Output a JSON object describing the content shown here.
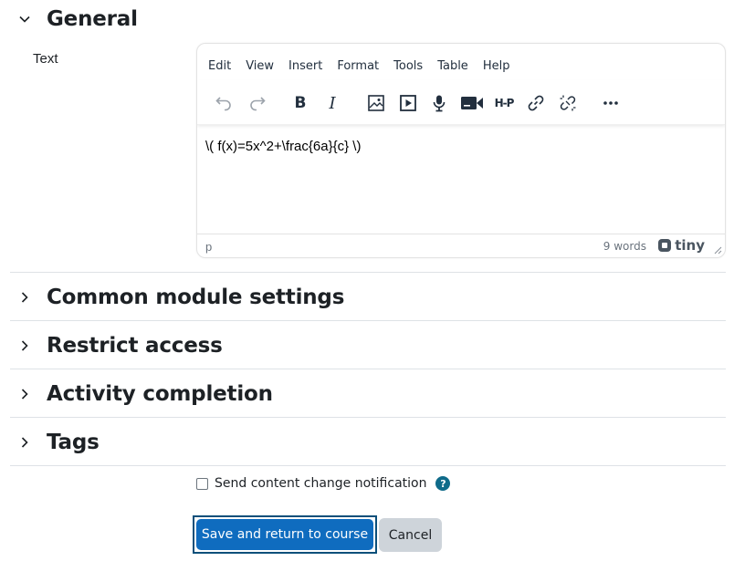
{
  "sections": {
    "general": {
      "title": "General",
      "expanded": true
    },
    "collapsed": [
      {
        "title": "Common module settings"
      },
      {
        "title": "Restrict access"
      },
      {
        "title": "Activity completion"
      },
      {
        "title": "Tags"
      }
    ]
  },
  "field": {
    "label": "Text"
  },
  "editor": {
    "menu": [
      "Edit",
      "View",
      "Insert",
      "Format",
      "Tools",
      "Table",
      "Help"
    ],
    "toolbar": [
      "undo-icon",
      "redo-icon",
      "bold-icon",
      "italic-icon",
      "image-icon",
      "media-icon",
      "record-audio-icon",
      "record-video-icon",
      "h5p-icon",
      "link-icon",
      "unlink-icon",
      "more-icon"
    ],
    "content": "\\( f(x)=5x^2+\\frac{6a}{c} \\)",
    "status_path": "p",
    "word_count": "9 words",
    "brand": "tiny"
  },
  "notification": {
    "label": "Send content change notification",
    "checked": false
  },
  "buttons": {
    "save": "Save and return to course",
    "cancel": "Cancel"
  },
  "colors": {
    "primary": "#0f6cbf",
    "help": "#0f6b8a",
    "secondary": "#ced4da"
  }
}
